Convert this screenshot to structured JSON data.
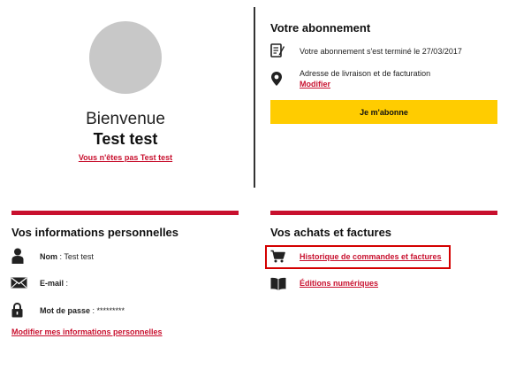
{
  "profile": {
    "welcome": "Bienvenue",
    "name": "Test test",
    "not_you_link": "Vous n'êtes pas Test test"
  },
  "subscription": {
    "title": "Votre abonnement",
    "status_text": "Votre abonnement s'est terminé le 27/03/2017",
    "address_label": "Adresse de livraison et de facturation",
    "modify_link": "Modifier",
    "subscribe_button": "Je m'abonne"
  },
  "personal_info": {
    "title": "Vos informations personnelles",
    "name_label": "Nom",
    "name_value": " : Test test",
    "email_label": "E-mail",
    "email_value": " :",
    "password_label": "Mot de passe",
    "password_value": " : *********",
    "modify_link": "Modifier mes informations personnelles"
  },
  "purchases": {
    "title": "Vos achats et factures",
    "history_link": "Historique de commandes et factures",
    "digital_link": "Éditions numériques"
  },
  "colors": {
    "accent_red": "#c8102e",
    "button_yellow": "#ffcc00",
    "highlight_red": "#d40000"
  },
  "icons": [
    "user-icon",
    "envelope-icon",
    "lock-icon",
    "document-edit-icon",
    "location-pin-icon",
    "cart-icon",
    "book-icon"
  ]
}
